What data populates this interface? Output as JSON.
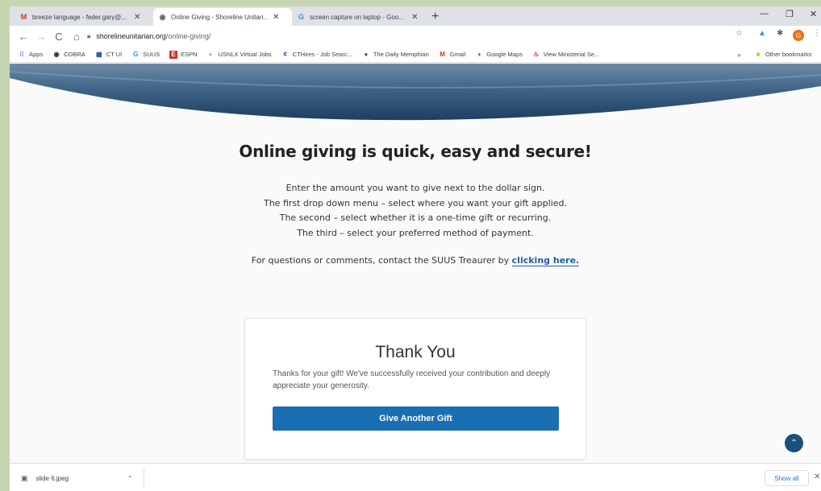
{
  "tabs": [
    {
      "title": "breeze language - feder.gary@...",
      "icon": "gmail-icon",
      "close": "✕"
    },
    {
      "title": "Online Giving - Shoreline Unitari...",
      "icon": "globe-icon",
      "close": "✕"
    },
    {
      "title": "screen capture on laptop - Goo...",
      "icon": "google-icon",
      "close": "✕"
    }
  ],
  "new_tab": "+",
  "window_controls": {
    "minimize": "—",
    "maximize": "❐",
    "close": "✕"
  },
  "nav": {
    "back": "←",
    "forward": "→",
    "reload": "C",
    "home": "⌂"
  },
  "address": {
    "domain": "shorelineunitarian.org",
    "path": "/online-giving/"
  },
  "toolbar_icons": {
    "star": "☆",
    "puzzle": "✱",
    "profile": "G",
    "menu": "⋮"
  },
  "bookmarks": [
    {
      "label": "Apps",
      "icon": "apps-grid-icon",
      "glyph": "⁞⁞"
    },
    {
      "label": "COBRA",
      "icon": "globe-icon",
      "glyph": "◉"
    },
    {
      "label": "CT UI",
      "icon": "ct-icon",
      "glyph": "▦"
    },
    {
      "label": "SUUS",
      "icon": "google-icon",
      "glyph": "G"
    },
    {
      "label": "ESPN",
      "icon": "espn-icon",
      "glyph": "E"
    },
    {
      "label": "USNLX Virtual Jobs",
      "icon": "usnlx-icon",
      "glyph": "◐"
    },
    {
      "label": "CTHires - Job Searc...",
      "icon": "cthires-icon",
      "glyph": "¢"
    },
    {
      "label": "The Daily Memphian",
      "icon": "daily-memphian-icon",
      "glyph": "●"
    },
    {
      "label": "Gmail",
      "icon": "gmail-icon",
      "glyph": "M"
    },
    {
      "label": "Google Maps",
      "icon": "map-pin-icon",
      "glyph": "♦"
    },
    {
      "label": "View Ministerial Se...",
      "icon": "ministerial-icon",
      "glyph": "♨"
    }
  ],
  "bookmarks_overflow": "»",
  "other_bookmarks": "Other bookmarks",
  "page": {
    "headline": "Online giving is quick, easy and secure!",
    "instructions": [
      "Enter the amount you want to give next to the dollar sign.",
      "The first drop down menu – select where you want your gift applied.",
      "The second – select whether it is a one-time gift or recurring.",
      "The third – select your preferred method of payment."
    ],
    "contact_text": "For questions or comments, contact the SUUS Treaurer by",
    "contact_link": "clicking here.",
    "card": {
      "title": "Thank You",
      "message": "Thanks for your gift! We've successfully received your contribution and deeply appreciate your generosity.",
      "button": "Give Another Gift"
    },
    "back_to_top": "⌃"
  },
  "download": {
    "filename": "slide 6.jpeg",
    "show_all": "Show all",
    "close": "✕",
    "chevron": "⌃"
  },
  "colors": {
    "accent": "#1a6fb3",
    "link": "#1f5fa8",
    "wave_dark": "#24496b"
  }
}
